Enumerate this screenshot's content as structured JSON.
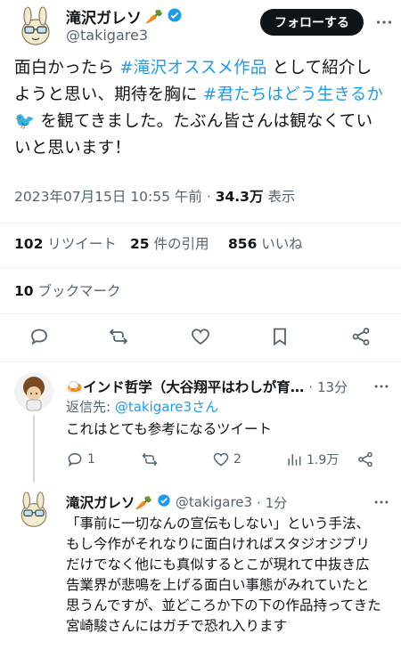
{
  "main_tweet": {
    "author_name": "滝沢ガレソ",
    "author_handle": "@takigare3",
    "follow_label": "フォローする",
    "text_segments": [
      {
        "t": "面白かったら ",
        "link": false
      },
      {
        "t": "#滝沢オススメ作品",
        "link": true
      },
      {
        "t": " として紹介しようと思い、期待を胸に ",
        "link": false
      },
      {
        "t": "#君たちはどう生きるか",
        "link": true
      },
      {
        "t": " 🐦 を観てきました。たぶん皆さんは観なくていいと思います！",
        "link": false
      }
    ],
    "timestamp": "2023年07月15日 10:55 午前 · ",
    "views_count": "34.3万",
    "views_label": " 表示",
    "retweets_count": "102",
    "retweets_label": "リツイート",
    "quotes_count": "25",
    "quotes_label": "件の引用",
    "likes_count": "856",
    "likes_label": "いいね",
    "bookmarks_count": "10",
    "bookmarks_label": "ブックマーク"
  },
  "replies": [
    {
      "name": "🍛インド哲学（大谷翔平はわしが育…",
      "time": "· 13分",
      "replying_prefix": "返信先: ",
      "replying_to": "@takigare3さん",
      "text": "これはとても参考になるツイート",
      "reply_count": "1",
      "retweet_count": "",
      "like_count": "2",
      "view_count": "1.9万"
    },
    {
      "name": "滝沢ガレソ🥕",
      "handle": "@takigare3",
      "time": "· 1分",
      "text": "「事前に一切なんの宣伝もしない」という手法、もし今作がそれなりに面白ければスタジオジブリだけでなく他にも真似するとこが現れて中抜き広告業界が悲鳴を上げる面白い事態がみれていたと思うんですが、並どころか下の下の作品持ってきた宮崎駿さんにはガチで恐れ入ります"
    }
  ]
}
